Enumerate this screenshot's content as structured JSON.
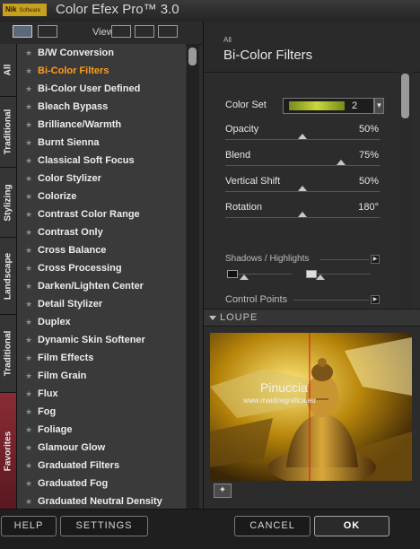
{
  "app": {
    "logo": "Nik",
    "logo_software": "Software",
    "title": "Color Efex Pro™ 3.0"
  },
  "views": {
    "label": "Views:"
  },
  "side_tabs": [
    {
      "label": "All"
    },
    {
      "label": "Traditional"
    },
    {
      "label": "Stylizing"
    },
    {
      "label": "Landscape"
    },
    {
      "label": "Traditional"
    },
    {
      "label": "Favorites"
    }
  ],
  "filters": {
    "selected": "Bi-Color Filters",
    "items": [
      "B/W Conversion",
      "Bi-Color Filters",
      "Bi-Color User Defined",
      "Bleach Bypass",
      "Brilliance/Warmth",
      "Burnt Sienna",
      "Classical Soft Focus",
      "Color Stylizer",
      "Colorize",
      "Contrast Color Range",
      "Contrast Only",
      "Cross Balance",
      "Cross Processing",
      "Darken/Lighten Center",
      "Detail Stylizer",
      "Duplex",
      "Dynamic Skin Softener",
      "Film Effects",
      "Film Grain",
      "Flux",
      "Fog",
      "Foliage",
      "Glamour Glow",
      "Graduated Filters",
      "Graduated Fog",
      "Graduated Neutral Density"
    ]
  },
  "panel": {
    "category": "All",
    "title": "Bi-Color Filters",
    "color_set": {
      "label": "Color Set",
      "value": "2"
    },
    "sliders": [
      {
        "label": "Opacity",
        "value_text": "50%",
        "level": 0.5
      },
      {
        "label": "Blend",
        "value_text": "75%",
        "level": 0.75
      },
      {
        "label": "Vertical Shift",
        "value_text": "50%",
        "level": 0.5
      },
      {
        "label": "Rotation",
        "value_text": "180°",
        "level": 0.5
      }
    ],
    "sections": {
      "shadows": "Shadows / Highlights",
      "control_points": "Control Points"
    }
  },
  "loupe": {
    "title": "LOUPE",
    "watermark": "Pinuccia",
    "watermark_url": "www.maidiregrafica.eu"
  },
  "buttons": {
    "help": "HELP",
    "settings": "SETTINGS",
    "cancel": "CANCEL",
    "ok": "OK"
  },
  "colors": {
    "selected_filter": "#ff9c1a",
    "favorites_tab": "#8a2c34"
  }
}
